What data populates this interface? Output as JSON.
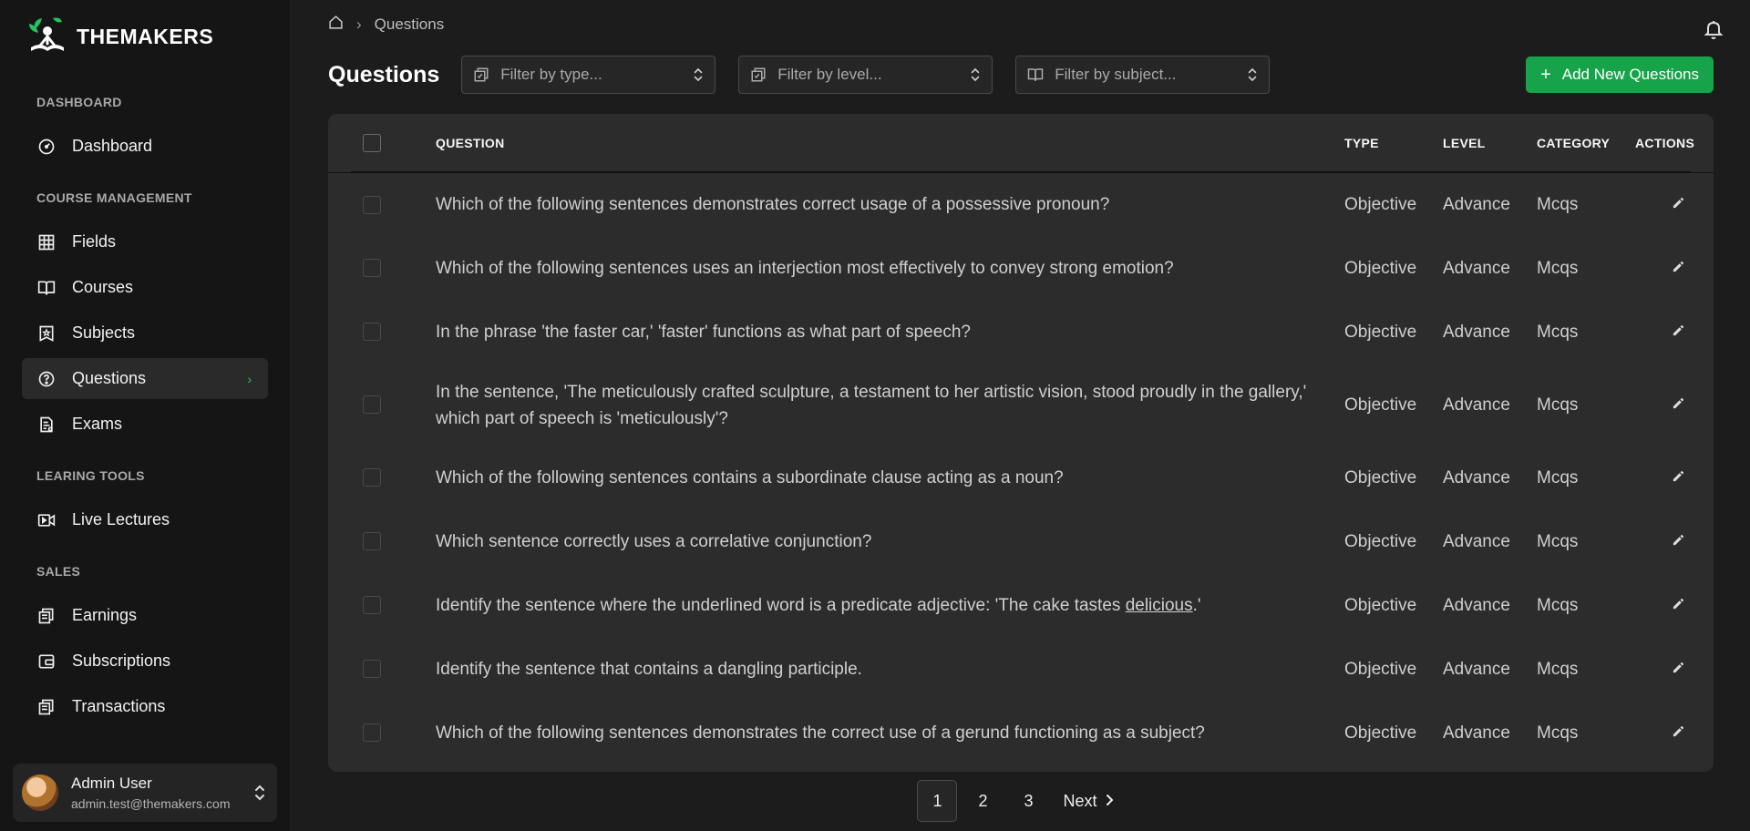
{
  "brand": {
    "name_part1": "THE",
    "name_part2": "MAKERS"
  },
  "sidebar": {
    "sections": [
      {
        "title": "DASHBOARD",
        "items": [
          {
            "label": "Dashboard",
            "icon": "gauge-icon"
          }
        ]
      },
      {
        "title": "COURSE MANAGEMENT",
        "items": [
          {
            "label": "Fields",
            "icon": "grid-icon"
          },
          {
            "label": "Courses",
            "icon": "book-open-icon"
          },
          {
            "label": "Subjects",
            "icon": "book-star-icon"
          },
          {
            "label": "Questions",
            "icon": "help-circle-icon",
            "active": true
          },
          {
            "label": "Exams",
            "icon": "document-icon"
          }
        ]
      },
      {
        "title": "LEARING TOOLS",
        "items": [
          {
            "label": "Live Lectures",
            "icon": "video-icon"
          }
        ]
      },
      {
        "title": "SALES",
        "items": [
          {
            "label": "Earnings",
            "icon": "receipts-icon"
          },
          {
            "label": "Subscriptions",
            "icon": "wallet-icon"
          },
          {
            "label": "Transactions",
            "icon": "receipts-icon"
          }
        ]
      }
    ]
  },
  "user": {
    "name": "Admin User",
    "email": "admin.test@themakers.com"
  },
  "breadcrumb": {
    "current": "Questions"
  },
  "page": {
    "title": "Questions"
  },
  "filters": {
    "type_placeholder": "Filter by type...",
    "level_placeholder": "Filter by level...",
    "subject_placeholder": "Filter by subject..."
  },
  "add_button": {
    "label": "Add New Questions"
  },
  "table": {
    "headers": {
      "question": "QUESTION",
      "type": "TYPE",
      "level": "LEVEL",
      "category": "CATEGORY",
      "actions": "ACTIONS"
    },
    "rows": [
      {
        "question": "Which of the following sentences demonstrates correct usage of a possessive pronoun?",
        "type": "Objective",
        "level": "Advance",
        "category": "Mcqs"
      },
      {
        "question": "Which of the following sentences uses an interjection most effectively to convey strong emotion?",
        "type": "Objective",
        "level": "Advance",
        "category": "Mcqs"
      },
      {
        "question": "In the phrase 'the faster car,' 'faster' functions as what part of speech?",
        "type": "Objective",
        "level": "Advance",
        "category": "Mcqs"
      },
      {
        "question": "In the sentence, 'The meticulously crafted sculpture, a testament to her artistic vision, stood proudly in the gallery,' which part of speech is 'meticulously'?",
        "type": "Objective",
        "level": "Advance",
        "category": "Mcqs"
      },
      {
        "question": "Which of the following sentences contains a subordinate clause acting as a noun?",
        "type": "Objective",
        "level": "Advance",
        "category": "Mcqs"
      },
      {
        "question": "Which sentence correctly uses a correlative conjunction?",
        "type": "Objective",
        "level": "Advance",
        "category": "Mcqs"
      },
      {
        "question_prefix": "Identify the sentence where the underlined word is a predicate adjective: 'The cake tastes ",
        "question_underlined": "delicious",
        "question_suffix": ".'",
        "type": "Objective",
        "level": "Advance",
        "category": "Mcqs"
      },
      {
        "question": "Identify the sentence that contains a dangling participle.",
        "type": "Objective",
        "level": "Advance",
        "category": "Mcqs"
      },
      {
        "question": "Which of the following sentences demonstrates the correct use of a gerund functioning as a subject?",
        "type": "Objective",
        "level": "Advance",
        "category": "Mcqs"
      }
    ]
  },
  "pagination": {
    "pages": [
      "1",
      "2",
      "3"
    ],
    "current": "1",
    "next_label": "Next"
  },
  "colors": {
    "accent": "#16a34a",
    "active_chevron": "#22c55e"
  }
}
